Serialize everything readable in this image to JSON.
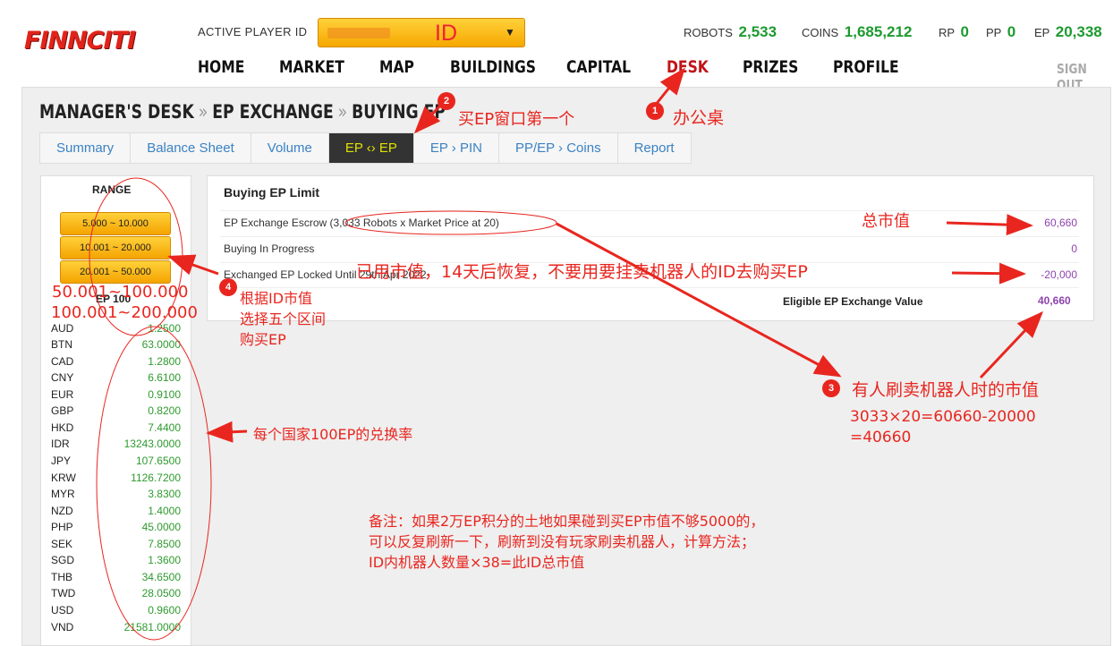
{
  "header": {
    "logo": "FINNCITI",
    "active_player_label": "ACTIVE PLAYER ID",
    "player_id": "ID",
    "stats": [
      {
        "label": "ROBOTS",
        "value": "2,533"
      },
      {
        "label": "COINS",
        "value": "1,685,212"
      },
      {
        "label": "RP",
        "value": "0"
      },
      {
        "label": "PP",
        "value": "0"
      },
      {
        "label": "EP",
        "value": "20,338"
      }
    ],
    "nav": [
      "HOME",
      "MARKET",
      "MAP",
      "BUILDINGS",
      "CAPITAL",
      "DESK",
      "PRIZES",
      "PROFILE"
    ],
    "active_nav": "DESK",
    "sign_out": "SIGN OUT"
  },
  "breadcrumb": [
    "MANAGER'S DESK",
    "EP EXCHANGE",
    "BUYING EP"
  ],
  "tabs": [
    "Summary",
    "Balance Sheet",
    "Volume",
    "EP ‹› EP",
    "EP › PIN",
    "PP/EP › Coins",
    "Report"
  ],
  "active_tab": "EP ‹› EP",
  "range": {
    "title": "RANGE",
    "buttons": [
      "5.000 ~ 10.000",
      "10.001 ~ 20.000",
      "20.001 ~ 50.000"
    ]
  },
  "rates": {
    "title": "EP 100",
    "items": [
      {
        "code": "AUD",
        "value": "1.2500"
      },
      {
        "code": "BTN",
        "value": "63.0000"
      },
      {
        "code": "CAD",
        "value": "1.2800"
      },
      {
        "code": "CNY",
        "value": "6.6100"
      },
      {
        "code": "EUR",
        "value": "0.9100"
      },
      {
        "code": "GBP",
        "value": "0.8200"
      },
      {
        "code": "HKD",
        "value": "7.4400"
      },
      {
        "code": "IDR",
        "value": "13243.0000"
      },
      {
        "code": "JPY",
        "value": "107.6500"
      },
      {
        "code": "KRW",
        "value": "1126.7200"
      },
      {
        "code": "MYR",
        "value": "3.8300"
      },
      {
        "code": "NZD",
        "value": "1.4000"
      },
      {
        "code": "PHP",
        "value": "45.0000"
      },
      {
        "code": "SEK",
        "value": "7.8500"
      },
      {
        "code": "SGD",
        "value": "1.3600"
      },
      {
        "code": "THB",
        "value": "34.6500"
      },
      {
        "code": "TWD",
        "value": "28.0500"
      },
      {
        "code": "USD",
        "value": "0.9600"
      },
      {
        "code": "VND",
        "value": "21581.0000"
      }
    ]
  },
  "limit": {
    "title": "Buying EP Limit",
    "rows": [
      {
        "label": "EP Exchange Escrow (3,033 Robots x Market Price at 20)",
        "value": "60,660"
      },
      {
        "label": "Buying In Progress",
        "value": "0"
      },
      {
        "label": "Exchanged EP Locked Until 29th Apr 2022",
        "value": "-20,000"
      }
    ],
    "eligible_label": "Eligible EP Exchange Value",
    "eligible_value": "40,660"
  },
  "annotations": {
    "n1": "1",
    "a1": "办公桌",
    "n2": "2",
    "a2": "买EP窗口第一个",
    "n3": "3",
    "a3": "有人刷卖机器人时的市值",
    "calc1": "3033×20=60660-20000",
    "calc2": "=40660",
    "n4": "4",
    "range_extra1": "50.001~100.000",
    "range_extra2": "100.001~200.000",
    "a4_1": "根据ID市值",
    "a4_2": "选择五个区间",
    "a4_3": "购买EP",
    "total": "总市值",
    "used": "已用市值，14天后恢复，不要用要挂卖机器人的ID去购买EP",
    "rate_note": "每个国家100EP的兑换率",
    "note1": "备注：如果2万EP积分的土地如果碰到买EP市值不够5000的，",
    "note2": "可以反复刷新一下，刷新到没有玩家刷卖机器人，计算方法；",
    "note3": "ID内机器人数量×38=此ID总市值"
  },
  "colors": {
    "accent_green": "#1e9a2f",
    "annotation_red": "#e8261f",
    "value_purple": "#8e44ad"
  }
}
